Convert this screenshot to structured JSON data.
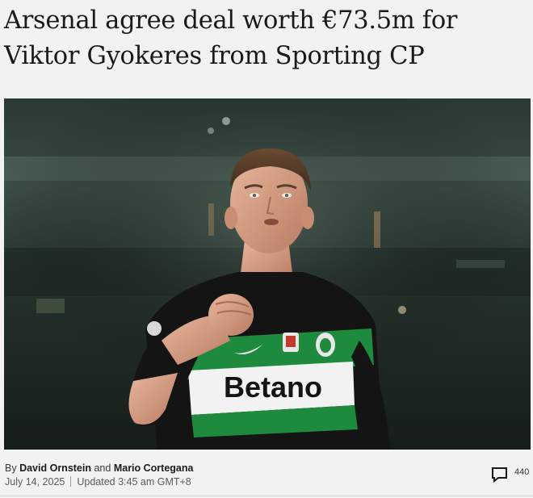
{
  "article": {
    "headline_line1": "Arsenal agree deal worth €73.5m for",
    "headline_line2": "Viktor Gyokeres from Sporting CP"
  },
  "photo": {
    "description_icon": "player-celebration-photo",
    "shirt_sponsor": "Betano",
    "colors": {
      "stadium_dark": "#1f2a24",
      "kit_green": "#1d8a3e",
      "kit_black": "#141414",
      "skin": "#d9a487"
    }
  },
  "byline": {
    "prefix": "By",
    "author1": "David Ornstein",
    "conjunction": "and",
    "author2": "Mario Cortegana"
  },
  "dateline": {
    "date": "July 14, 2025",
    "updated": "Updated 3:45 am GMT+8"
  },
  "comments": {
    "icon": "comment-icon",
    "count": "440"
  }
}
